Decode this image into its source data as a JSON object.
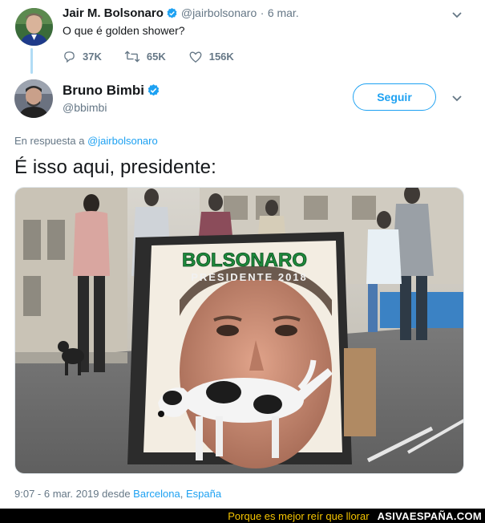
{
  "tweet1": {
    "name": "Jair M. Bolsonaro",
    "handle": "@jairbolsonaro",
    "separator": "·",
    "date": "6 mar.",
    "text": "O que é golden shower?",
    "stats": {
      "replies": "37K",
      "retweets": "65K",
      "likes": "156K"
    }
  },
  "tweet2": {
    "name": "Bruno Bimbi",
    "handle": "@bbimbi",
    "follow_label": "Seguir",
    "reply_prefix": "En respuesta a",
    "reply_to": "@jairbolsonaro",
    "text": "É isso aqui, presidente:",
    "image": {
      "poster_title": "BOLSONARO",
      "poster_subtitle": "PRESIDENTE 2018"
    },
    "timestamp": "9:07 - 6 mar. 2019 desde",
    "location_city": "Barcelona",
    "location_sep": ",",
    "location_country": "España"
  },
  "footer": {
    "tagline": "Porque es mejor reír que llorar",
    "brand": "ASIVAESPAÑA.COM"
  },
  "colors": {
    "accent": "#1da1f2",
    "muted": "#657786",
    "footer_bg": "#000000",
    "tagline": "#f5c400"
  }
}
